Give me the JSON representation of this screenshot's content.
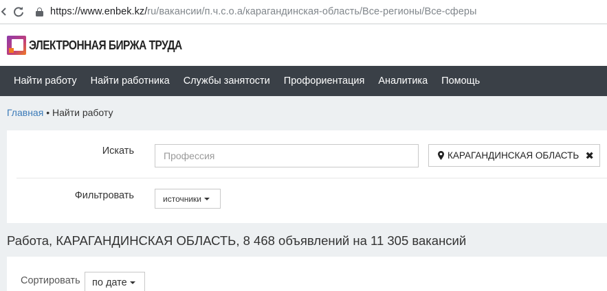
{
  "browser": {
    "back_icon": "back-arrow-icon",
    "reload_icon": "reload-icon",
    "url_host": "https://www.enbek.kz/",
    "url_path": "ru/вакансии/п.ч.с.о.а/карагандинская-область/Все-регионы/Все-сферы"
  },
  "header": {
    "logo_text": "ЭЛЕКТРОННАЯ БИРЖА ТРУДА"
  },
  "nav": {
    "items": [
      {
        "label": "Найти работу"
      },
      {
        "label": "Найти работника"
      },
      {
        "label": "Службы занятости"
      },
      {
        "label": "Профориентация"
      },
      {
        "label": "Аналитика"
      },
      {
        "label": "Помощь"
      }
    ]
  },
  "breadcrumb": {
    "home": "Главная",
    "separator": "•",
    "current": "Найти работу"
  },
  "search": {
    "search_label": "Искать",
    "profession_placeholder": "Профессия",
    "region_value": "КАРАГАНДИНСКАЯ ОБЛАСТЬ",
    "region_close": "✖",
    "filter_label": "Фильтровать",
    "sources_button": "источники"
  },
  "results": {
    "title": "Работа, КАРАГАНДИНСКАЯ ОБЛАСТЬ, 8 468 объявлений на 11 305 вакансий"
  },
  "sort": {
    "label": "Сортировать",
    "selected": "по дате"
  },
  "colors": {
    "nav_bg": "#3a4047",
    "link": "#3a7ab8",
    "page_bg": "#edf0f2",
    "logo_accent_purple": "#8e3aa9",
    "logo_accent_orange": "#f07b22"
  }
}
